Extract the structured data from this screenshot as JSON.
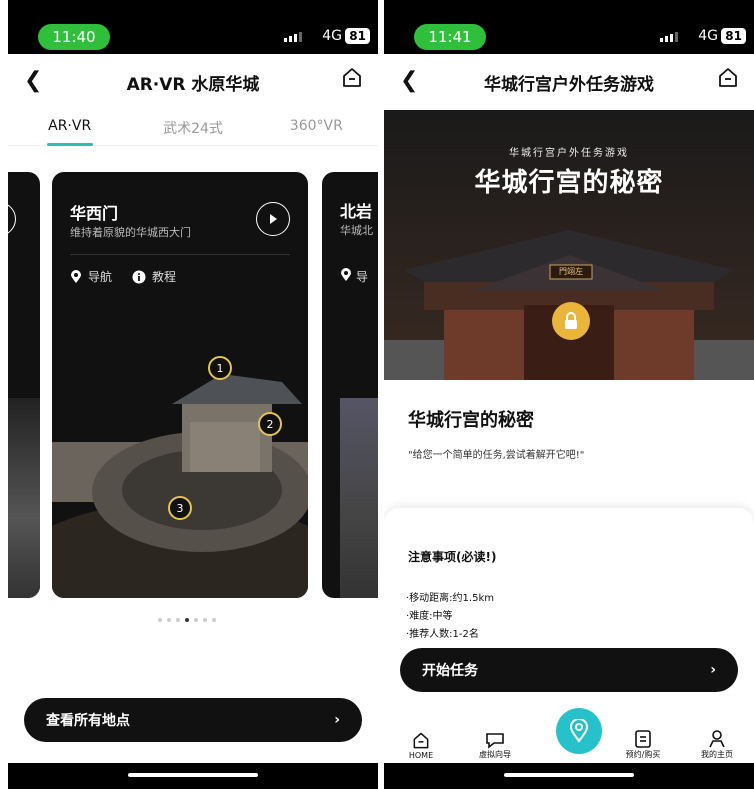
{
  "left": {
    "status": {
      "time": "11:40",
      "network": "4G",
      "battery": "81"
    },
    "header": {
      "title": "AR·VR 水原华城"
    },
    "tabs": [
      {
        "label": "AR·VR"
      },
      {
        "label": "武术24式"
      },
      {
        "label": "360°VR"
      }
    ],
    "card": {
      "title": "华西门",
      "subtitle": "维持着原貌的华城西大门",
      "nav_label": "导航",
      "tutorial_label": "教程",
      "markers": [
        "1",
        "2",
        "3"
      ]
    },
    "side_card": {
      "title": "北岩",
      "subtitle": "华城北",
      "nav_label": "导"
    },
    "dots_active_index": 3,
    "bottom_button": {
      "label": "查看所有地点"
    }
  },
  "right": {
    "status": {
      "time": "11:41",
      "network": "4G",
      "battery": "81"
    },
    "header": {
      "title": "华城行宫户外任务游戏"
    },
    "hero": {
      "subtitle": "华城行宫户外任务游戏",
      "title": "华城行宫的秘密",
      "sign": "門翊左"
    },
    "section": {
      "title": "华城行宫的秘密",
      "desc": "\"给您一个简单的任务,尝试着解开它吧!\""
    },
    "notice": {
      "title": "注意事项(必读!)",
      "items": [
        "·移动距离:约1.5km",
        "·难度:中等",
        "·推荐人数:1-2名"
      ]
    },
    "start_button": {
      "label": "开始任务"
    },
    "tabbar": [
      {
        "label": "HOME",
        "icon": "home-icon"
      },
      {
        "label": "虚拟向导",
        "icon": "chat-icon"
      },
      {
        "label": "",
        "icon": "location-pin-icon"
      },
      {
        "label": "预约/购买",
        "icon": "ticket-icon"
      },
      {
        "label": "我的主页",
        "icon": "user-icon"
      }
    ]
  },
  "colors": {
    "accent": "#26c1c9",
    "status_green": "#2fbf3a",
    "tab_underline": "#2dbfb0"
  }
}
